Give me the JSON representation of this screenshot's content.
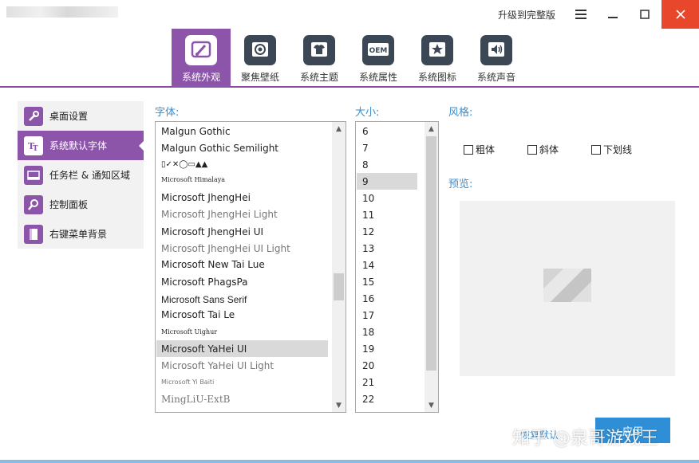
{
  "titlebar": {
    "upgrade_label": "升级到完整版"
  },
  "topnav": {
    "tabs": [
      {
        "label": "系统外观",
        "icon": "paintbrush-icon",
        "active": true
      },
      {
        "label": "聚焦壁纸",
        "icon": "focus-target-icon",
        "active": false
      },
      {
        "label": "系统主题",
        "icon": "tshirt-icon",
        "active": false
      },
      {
        "label": "系统属性",
        "icon": "oem-icon",
        "active": false,
        "icon_text": "OEM"
      },
      {
        "label": "系统图标",
        "icon": "star-icon",
        "active": false
      },
      {
        "label": "系统声音",
        "icon": "speaker-icon",
        "active": false
      }
    ]
  },
  "sidebar": {
    "items": [
      {
        "label": "桌面设置",
        "icon": "wrench-icon",
        "active": false
      },
      {
        "label": "系统默认字体",
        "icon": "font-icon",
        "active": true
      },
      {
        "label": "任务栏 & 通知区域",
        "icon": "taskbar-icon",
        "active": false
      },
      {
        "label": "控制面板",
        "icon": "magnifier-icon",
        "active": false
      },
      {
        "label": "右键菜单背景",
        "icon": "context-menu-icon",
        "active": false
      }
    ]
  },
  "font": {
    "label": "字体:",
    "items": [
      "Malgun Gothic",
      "Malgun Gothic Semilight",
      "▯✓✕◯▭▲▲",
      "Microsoft Himalaya",
      "Microsoft JhengHei",
      "Microsoft JhengHei Light",
      "Microsoft JhengHei UI",
      "Microsoft JhengHei UI Light",
      "Microsoft New Tai Lue",
      "Microsoft PhagsPa",
      "Microsoft Sans Serif",
      "Microsoft Tai Le",
      "Microsoft Uighur",
      "Microsoft YaHei UI",
      "Microsoft YaHei UI Light",
      "Microsoft Yi Baiti",
      "MingLiU-ExtB"
    ],
    "selected": "Microsoft YaHei UI"
  },
  "size": {
    "label": "大小:",
    "items": [
      "6",
      "7",
      "8",
      "9",
      "10",
      "11",
      "12",
      "13",
      "14",
      "15",
      "16",
      "17",
      "18",
      "19",
      "20",
      "21",
      "22"
    ],
    "selected": "9"
  },
  "style": {
    "label": "风格:",
    "options": [
      {
        "label": "粗体",
        "checked": false
      },
      {
        "label": "斜体",
        "checked": false
      },
      {
        "label": "下划线",
        "checked": false
      }
    ]
  },
  "preview": {
    "label": "预览:"
  },
  "actions": {
    "restore_label": "恢复默认",
    "apply_label": "应用"
  },
  "watermark": "知乎 @泉哥游戏王",
  "colors": {
    "accent_purple": "#8d55aa",
    "link_blue": "#3a8ed0",
    "close_red": "#e8472b",
    "apply_blue": "#2f8fd6"
  }
}
